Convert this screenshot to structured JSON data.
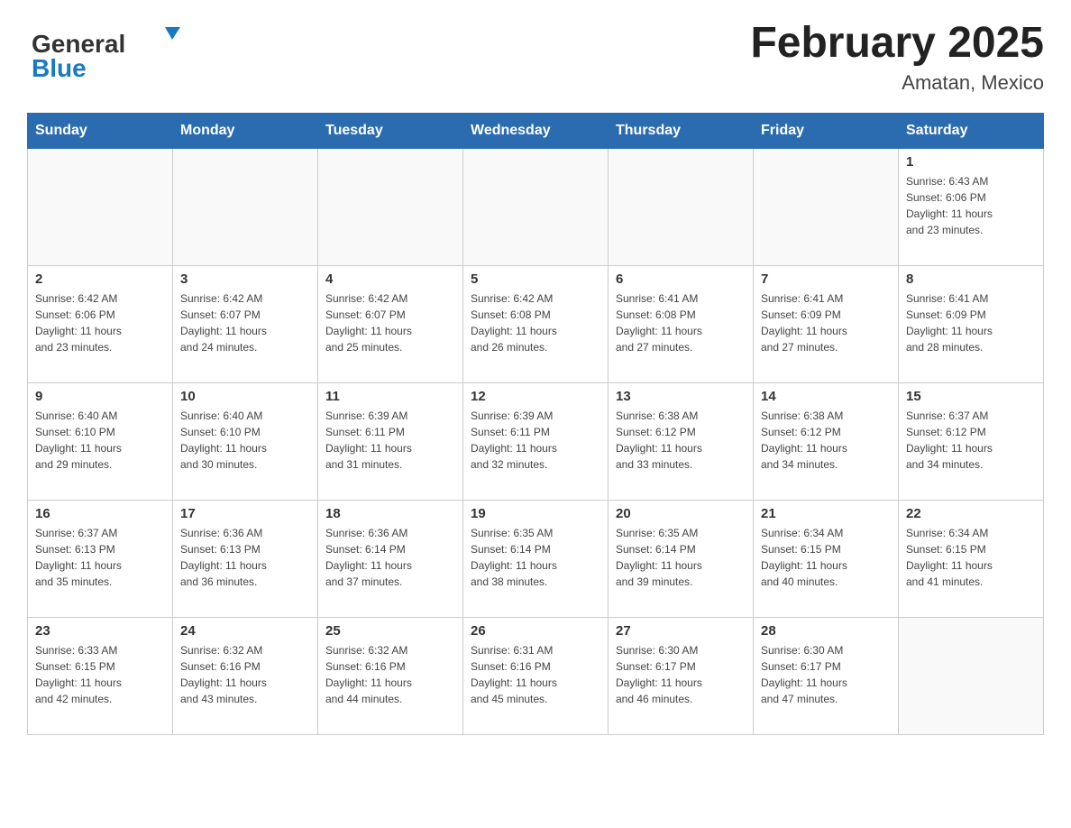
{
  "header": {
    "logo_general": "General",
    "logo_blue": "Blue",
    "title": "February 2025",
    "subtitle": "Amatan, Mexico"
  },
  "weekdays": [
    "Sunday",
    "Monday",
    "Tuesday",
    "Wednesday",
    "Thursday",
    "Friday",
    "Saturday"
  ],
  "weeks": [
    [
      {
        "day": "",
        "info": ""
      },
      {
        "day": "",
        "info": ""
      },
      {
        "day": "",
        "info": ""
      },
      {
        "day": "",
        "info": ""
      },
      {
        "day": "",
        "info": ""
      },
      {
        "day": "",
        "info": ""
      },
      {
        "day": "1",
        "info": "Sunrise: 6:43 AM\nSunset: 6:06 PM\nDaylight: 11 hours\nand 23 minutes."
      }
    ],
    [
      {
        "day": "2",
        "info": "Sunrise: 6:42 AM\nSunset: 6:06 PM\nDaylight: 11 hours\nand 23 minutes."
      },
      {
        "day": "3",
        "info": "Sunrise: 6:42 AM\nSunset: 6:07 PM\nDaylight: 11 hours\nand 24 minutes."
      },
      {
        "day": "4",
        "info": "Sunrise: 6:42 AM\nSunset: 6:07 PM\nDaylight: 11 hours\nand 25 minutes."
      },
      {
        "day": "5",
        "info": "Sunrise: 6:42 AM\nSunset: 6:08 PM\nDaylight: 11 hours\nand 26 minutes."
      },
      {
        "day": "6",
        "info": "Sunrise: 6:41 AM\nSunset: 6:08 PM\nDaylight: 11 hours\nand 27 minutes."
      },
      {
        "day": "7",
        "info": "Sunrise: 6:41 AM\nSunset: 6:09 PM\nDaylight: 11 hours\nand 27 minutes."
      },
      {
        "day": "8",
        "info": "Sunrise: 6:41 AM\nSunset: 6:09 PM\nDaylight: 11 hours\nand 28 minutes."
      }
    ],
    [
      {
        "day": "9",
        "info": "Sunrise: 6:40 AM\nSunset: 6:10 PM\nDaylight: 11 hours\nand 29 minutes."
      },
      {
        "day": "10",
        "info": "Sunrise: 6:40 AM\nSunset: 6:10 PM\nDaylight: 11 hours\nand 30 minutes."
      },
      {
        "day": "11",
        "info": "Sunrise: 6:39 AM\nSunset: 6:11 PM\nDaylight: 11 hours\nand 31 minutes."
      },
      {
        "day": "12",
        "info": "Sunrise: 6:39 AM\nSunset: 6:11 PM\nDaylight: 11 hours\nand 32 minutes."
      },
      {
        "day": "13",
        "info": "Sunrise: 6:38 AM\nSunset: 6:12 PM\nDaylight: 11 hours\nand 33 minutes."
      },
      {
        "day": "14",
        "info": "Sunrise: 6:38 AM\nSunset: 6:12 PM\nDaylight: 11 hours\nand 34 minutes."
      },
      {
        "day": "15",
        "info": "Sunrise: 6:37 AM\nSunset: 6:12 PM\nDaylight: 11 hours\nand 34 minutes."
      }
    ],
    [
      {
        "day": "16",
        "info": "Sunrise: 6:37 AM\nSunset: 6:13 PM\nDaylight: 11 hours\nand 35 minutes."
      },
      {
        "day": "17",
        "info": "Sunrise: 6:36 AM\nSunset: 6:13 PM\nDaylight: 11 hours\nand 36 minutes."
      },
      {
        "day": "18",
        "info": "Sunrise: 6:36 AM\nSunset: 6:14 PM\nDaylight: 11 hours\nand 37 minutes."
      },
      {
        "day": "19",
        "info": "Sunrise: 6:35 AM\nSunset: 6:14 PM\nDaylight: 11 hours\nand 38 minutes."
      },
      {
        "day": "20",
        "info": "Sunrise: 6:35 AM\nSunset: 6:14 PM\nDaylight: 11 hours\nand 39 minutes."
      },
      {
        "day": "21",
        "info": "Sunrise: 6:34 AM\nSunset: 6:15 PM\nDaylight: 11 hours\nand 40 minutes."
      },
      {
        "day": "22",
        "info": "Sunrise: 6:34 AM\nSunset: 6:15 PM\nDaylight: 11 hours\nand 41 minutes."
      }
    ],
    [
      {
        "day": "23",
        "info": "Sunrise: 6:33 AM\nSunset: 6:15 PM\nDaylight: 11 hours\nand 42 minutes."
      },
      {
        "day": "24",
        "info": "Sunrise: 6:32 AM\nSunset: 6:16 PM\nDaylight: 11 hours\nand 43 minutes."
      },
      {
        "day": "25",
        "info": "Sunrise: 6:32 AM\nSunset: 6:16 PM\nDaylight: 11 hours\nand 44 minutes."
      },
      {
        "day": "26",
        "info": "Sunrise: 6:31 AM\nSunset: 6:16 PM\nDaylight: 11 hours\nand 45 minutes."
      },
      {
        "day": "27",
        "info": "Sunrise: 6:30 AM\nSunset: 6:17 PM\nDaylight: 11 hours\nand 46 minutes."
      },
      {
        "day": "28",
        "info": "Sunrise: 6:30 AM\nSunset: 6:17 PM\nDaylight: 11 hours\nand 47 minutes."
      },
      {
        "day": "",
        "info": ""
      }
    ]
  ]
}
